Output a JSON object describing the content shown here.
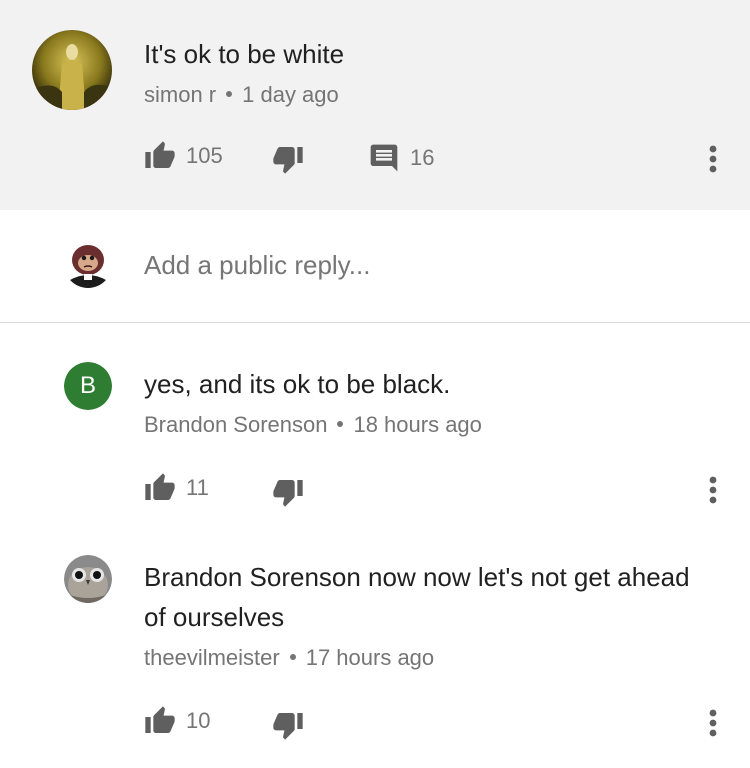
{
  "top_comment": {
    "text": "It's ok to be white",
    "author": "simon r",
    "time": "1 day ago",
    "likes": "105",
    "replies": "16",
    "avatar_icon": "user-photo-avatar"
  },
  "reply_box": {
    "placeholder": "Add a public reply...",
    "avatar_icon": "gorilla-avatar"
  },
  "replies": [
    {
      "text": "yes, and its ok to be black.",
      "author": "Brandon Sorenson",
      "time": "18 hours ago",
      "likes": "11",
      "avatar_letter": "B",
      "avatar_color": "#2e7d32"
    },
    {
      "text": "Brandon Sorenson now now let's not get ahead of ourselves",
      "author": "theevilmeister",
      "time": "17 hours ago",
      "likes": "10",
      "avatar_icon": "owl-avatar"
    }
  ],
  "colors": {
    "highlight_bg": "#f2f2f2",
    "icon_color": "#5f5f5f",
    "meta_text": "#757575"
  }
}
